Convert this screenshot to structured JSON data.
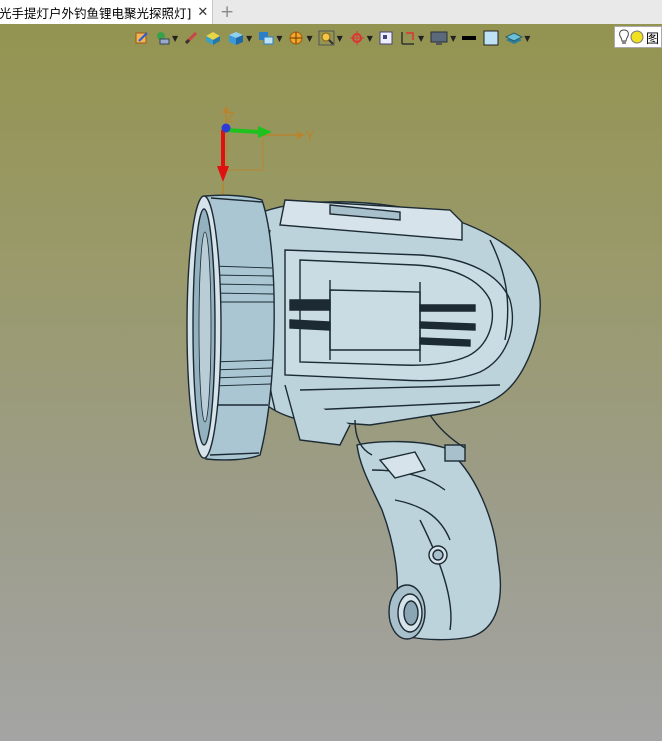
{
  "tab": {
    "title": "光手提灯户外钓鱼锂电聚光探照灯]",
    "close_glyph": "✕",
    "add_glyph": "+"
  },
  "toolbar": {
    "items": [
      "sketch-icon",
      "shade-mode-icon",
      "measure-icon",
      "solid-box-icon",
      "cube-view-icon",
      "display-style-icon",
      "section-view-icon",
      "zoom-fit-icon",
      "snap-icon",
      "grid-icon",
      "dimension-icon",
      "monitor-icon",
      "line-color-icon",
      "fill-color-icon",
      "layer-icon"
    ],
    "layer_label": "图"
  },
  "axis": {
    "z_label": "Z",
    "y_label": "Y"
  },
  "colors": {
    "x_axis": "#e01010",
    "y_axis": "#1ec21e",
    "z_axis": "#2d3bd6",
    "triad_arrow": "#b8842e",
    "model_body": "#bcd3db",
    "model_edge": "#1c2a33"
  }
}
